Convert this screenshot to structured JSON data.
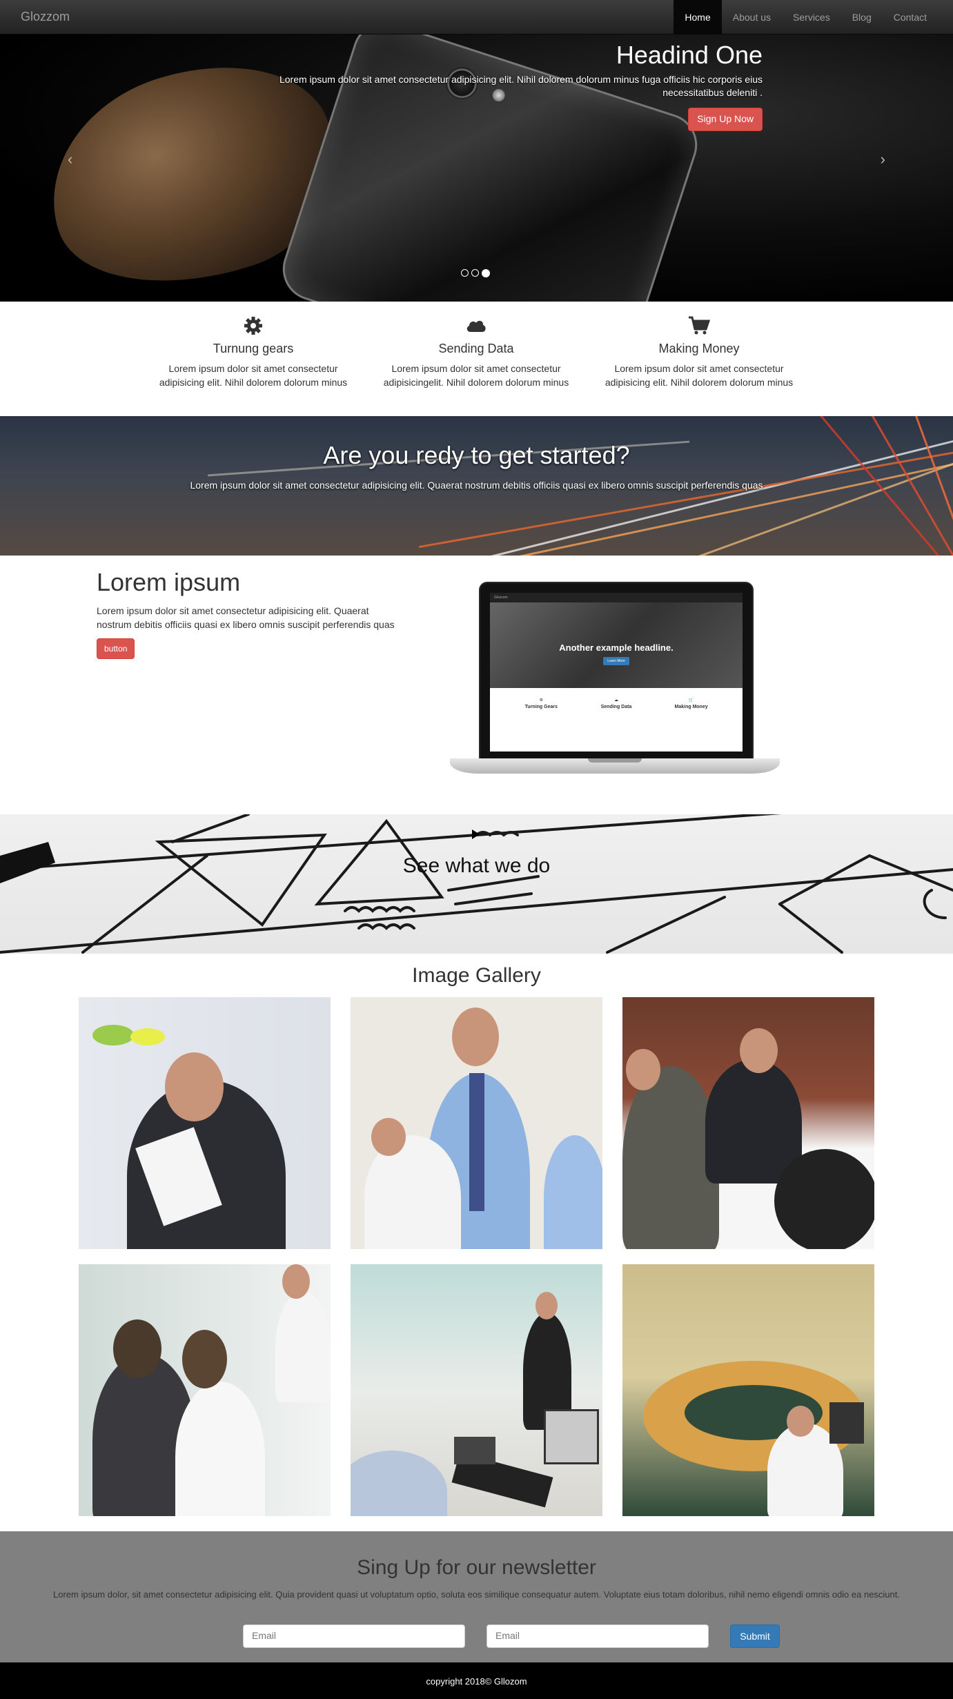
{
  "navbar": {
    "brand": "Glozzom",
    "items": [
      {
        "label": "Home",
        "active": true
      },
      {
        "label": "About us",
        "active": false
      },
      {
        "label": "Services",
        "active": false
      },
      {
        "label": "Blog",
        "active": false
      },
      {
        "label": "Contact",
        "active": false
      }
    ]
  },
  "hero": {
    "heading": "Headind One",
    "description": "Lorem ipsum dolor sit amet consectetur adipisicing elit. Nihil dolorem dolorum minus fuga officiis hic corporis eius necessitatibus deleniti .",
    "button_label": "Sign Up Now",
    "prev_arrow": "‹",
    "next_arrow": "›",
    "slides_count": 3,
    "active_slide": 3
  },
  "features": [
    {
      "icon": "gear-icon",
      "title": "Turnung gears",
      "text": "Lorem ipsum dolor sit amet consectetur adipisicing elit. Nihil dolorem dolorum minus"
    },
    {
      "icon": "cloud-icon",
      "title": "Sending Data",
      "text": "Lorem ipsum dolor sit amet consectetur adipisicingelit. Nihil dolorem dolorum minus"
    },
    {
      "icon": "shopping-cart-icon",
      "title": "Making Money",
      "text": "Lorem ipsum dolor sit amet consectetur adipisicing elit. Nihil dolorem dolorum minus"
    }
  ],
  "get_started": {
    "title": "Are you redy to get started?",
    "text": "Lorem ipsum dolor sit amet consectetur adipisicing elit. Quaerat nostrum debitis officiis quasi ex libero omnis suscipit perferendis quas"
  },
  "lorem_section": {
    "title": "Lorem ipsum",
    "text": "Lorem ipsum dolor sit amet consectetur adipisicing elit. Quaerat nostrum debitis officiis quasi ex libero omnis suscipit perferendis quas",
    "button_label": "button",
    "laptop_screen": {
      "brand": "Glozzom",
      "headline": "Another example headline.",
      "button": "Learn More",
      "features": [
        "Turning Gears",
        "Sending Data",
        "Making Money"
      ]
    }
  },
  "video_section": {
    "title": "See what we do"
  },
  "gallery": {
    "title": "Image Gallery"
  },
  "newsletter": {
    "title": "Sing Up for our newsletter",
    "text": "Lorem ipsum dolor, sit amet consectetur adipisicing elit. Quia provident quasi ut voluptatum optio, soluta eos similique consequatur autem. Voluptate eius totam doloribus, nihil nemo eligendi omnis odio ea nesciunt.",
    "input1_placeholder": "Email",
    "input2_placeholder": "Email",
    "submit_label": "Submit"
  },
  "footer": {
    "copyright": "copyright 2018© Gllozom"
  },
  "colors": {
    "nav_bg": "#222222",
    "accent_red": "#d9534f",
    "accent_blue": "#337ab7",
    "newsletter_bg": "#808080",
    "footer_bg": "#000000"
  }
}
